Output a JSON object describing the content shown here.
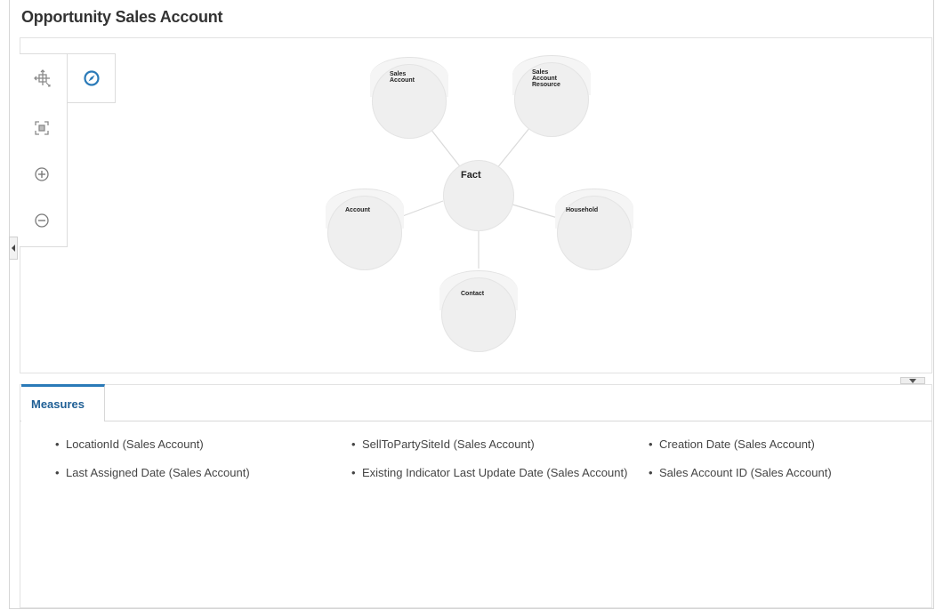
{
  "page": {
    "title": "Opportunity Sales Account"
  },
  "toolbar": {
    "items": [
      {
        "icon": "pan-icon"
      },
      {
        "icon": "compass-icon"
      },
      {
        "icon": "zoom-fit-icon"
      },
      {
        "icon": "zoom-in-icon"
      },
      {
        "icon": "zoom-out-icon"
      }
    ]
  },
  "diagram": {
    "center": "Fact",
    "nodes": [
      {
        "label": "Sales\nAccount"
      },
      {
        "label": "Sales\nAccount\nResource"
      },
      {
        "label": "Account"
      },
      {
        "label": "Household"
      },
      {
        "label": "Contact"
      }
    ]
  },
  "tabs": [
    {
      "label": "Measures"
    }
  ],
  "measures": [
    "LocationId (Sales Account)",
    "SellToPartySiteId (Sales Account)",
    "Creation Date (Sales Account)",
    "Last Assigned Date (Sales Account)",
    "Existing Indicator Last Update Date (Sales Account)",
    "Sales Account ID (Sales Account)"
  ],
  "colors": {
    "accent": "#2a7ab8",
    "node": "#efefef",
    "tab_text": "#1f5f95"
  }
}
